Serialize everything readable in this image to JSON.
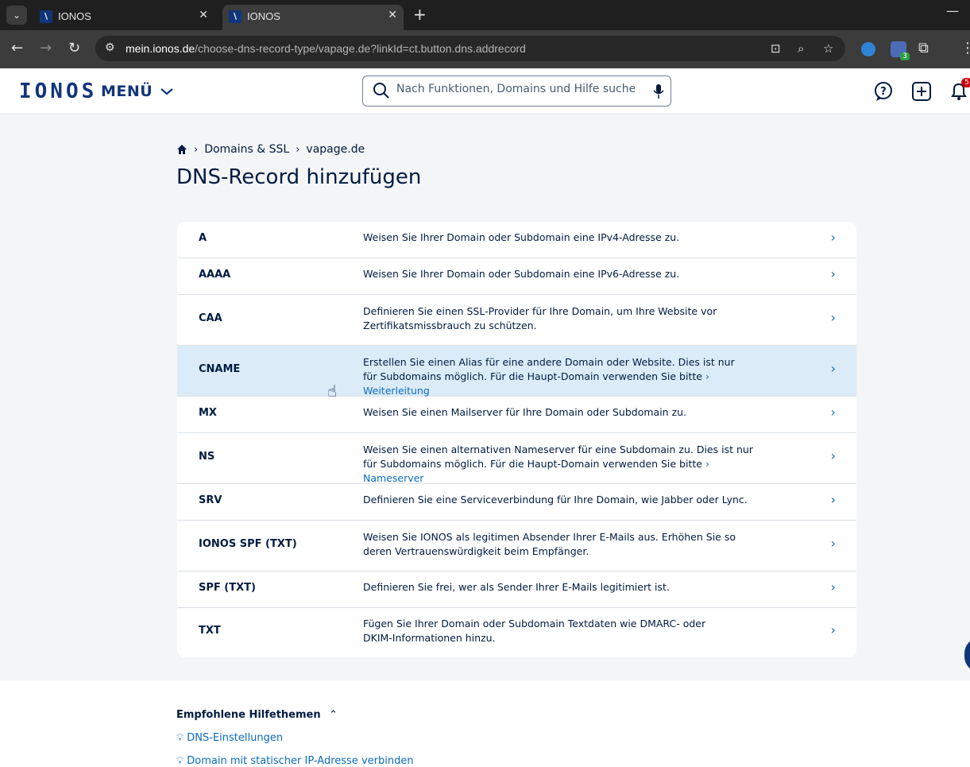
{
  "browser": {
    "tabs": [
      {
        "title": "IONOS",
        "active": false
      },
      {
        "title": "IONOS",
        "active": true
      }
    ],
    "url_host": "mein.ionos.de",
    "url_path": "/choose-dns-record-type/vapage.de?linkId=ct.button.dns.addrecord",
    "extension_badge": "3"
  },
  "header": {
    "logo": "IONOS",
    "menu_label": "MENÜ",
    "search_placeholder": "Nach Funktionen, Domains und Hilfe suchen",
    "notification_count": "5"
  },
  "breadcrumb": {
    "items": [
      "Domains & SSL",
      "vapage.de"
    ]
  },
  "page": {
    "title": "DNS-Record hinzufügen"
  },
  "records": [
    {
      "type": "A",
      "desc": "Weisen Sie Ihrer Domain oder Subdomain eine IPv4-Adresse zu."
    },
    {
      "type": "AAAA",
      "desc": "Weisen Sie Ihrer Domain oder Subdomain eine IPv6-Adresse zu."
    },
    {
      "type": "CAA",
      "desc": "Definieren Sie einen SSL-Provider für Ihre Domain, um Ihre Website vor Zertifikatsmissbrauch zu schützen."
    },
    {
      "type": "CNAME",
      "desc": "Erstellen Sie einen Alias für eine andere Domain oder Website. Dies ist nur für Subdomains möglich. Für die Haupt-Domain verwenden Sie bitte",
      "link": "Weiterleitung"
    },
    {
      "type": "MX",
      "desc": "Weisen Sie einen Mailserver für Ihre Domain oder Subdomain zu."
    },
    {
      "type": "NS",
      "desc": "Weisen Sie einen alternativen Nameserver für eine Subdomain zu. Dies ist nur für Subdomains möglich. Für die Haupt-Domain verwenden Sie bitte",
      "link": "Nameserver"
    },
    {
      "type": "SRV",
      "desc": "Definieren Sie eine Serviceverbindung für Ihre Domain, wie Jabber oder Lync."
    },
    {
      "type": "IONOS SPF (TXT)",
      "desc": "Weisen Sie IONOS als legitimen Absender Ihrer E-Mails aus. Erhöhen Sie so deren Vertrauenswürdigkeit beim Empfänger."
    },
    {
      "type": "SPF (TXT)",
      "desc": "Definieren Sie frei, wer als Sender Ihrer E-Mails legitimiert ist."
    },
    {
      "type": "TXT",
      "desc": "Fügen Sie Ihrer Domain oder Subdomain Textdaten wie DMARC- oder DKIM-Informationen hinzu."
    }
  ],
  "help": {
    "title": "Empfohlene Hilfethemen",
    "links": [
      "DNS-Einstellungen",
      "Domain mit statischer IP-Adresse verbinden"
    ]
  },
  "colors": {
    "brand": "#11357a",
    "link": "#0b6bc0",
    "hover_row": "#dbecf8"
  }
}
